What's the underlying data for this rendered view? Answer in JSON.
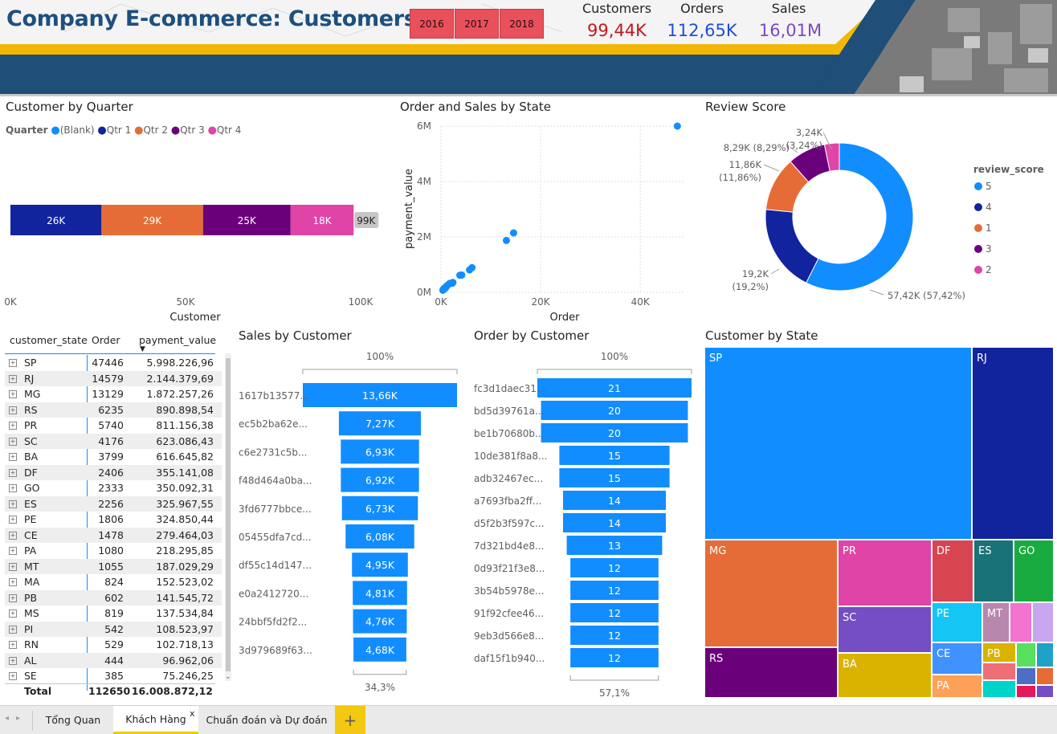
{
  "header": {
    "title": "Company E-commerce: Customers",
    "years": [
      "2016",
      "2017",
      "2018"
    ],
    "kpis": [
      {
        "label": "Customers",
        "value": "99,44K",
        "color": "#c4161c"
      },
      {
        "label": "Orders",
        "value": "112,65K",
        "color": "#1f4fd6"
      },
      {
        "label": "Sales",
        "value": "16,01M",
        "color": "#7b48c8"
      }
    ]
  },
  "colors": {
    "blue": "#118dff",
    "navy": "#12239e",
    "orange": "#e66c37",
    "purple": "#6b007b",
    "pink": "#e044a7",
    "header_band": "#1f4e79",
    "header_gold": "#f2b705"
  },
  "customer_by_quarter": {
    "title": "Customer by Quarter",
    "legend_title": "Quarter",
    "legend": [
      "(Blank)",
      "Qtr 1",
      "Qtr 2",
      "Qtr 3",
      "Qtr 4"
    ],
    "xlabel": "Customer",
    "ticks": [
      "0K",
      "50K",
      "100K"
    ]
  },
  "order_sales_by_state": {
    "title": "Order and Sales by State",
    "xlabel": "Order",
    "ylabel": "payment_value",
    "xticks": [
      "0K",
      "20K",
      "40K"
    ],
    "yticks": [
      "0M",
      "2M",
      "4M",
      "6M"
    ]
  },
  "review_score": {
    "title": "Review Score",
    "legend_title": "review_score",
    "legend": [
      "5",
      "4",
      "1",
      "3",
      "2"
    ],
    "labels": [
      "57,42K (57,42%)",
      "19,2K",
      "(19,2%)",
      "11,86K",
      "(11,86%)",
      "8,29K (8,29%)",
      "3,24K",
      "(3,24%)"
    ]
  },
  "table": {
    "headers": [
      "customer_state",
      "Order",
      "payment_value"
    ],
    "rows": [
      {
        "state": "SP",
        "order": "47446",
        "pay": "5.998.226,96"
      },
      {
        "state": "RJ",
        "order": "14579",
        "pay": "2.144.379,69"
      },
      {
        "state": "MG",
        "order": "13129",
        "pay": "1.872.257,26"
      },
      {
        "state": "RS",
        "order": "6235",
        "pay": "890.898,54"
      },
      {
        "state": "PR",
        "order": "5740",
        "pay": "811.156,38"
      },
      {
        "state": "SC",
        "order": "4176",
        "pay": "623.086,43"
      },
      {
        "state": "BA",
        "order": "3799",
        "pay": "616.645,82"
      },
      {
        "state": "DF",
        "order": "2406",
        "pay": "355.141,08"
      },
      {
        "state": "GO",
        "order": "2333",
        "pay": "350.092,31"
      },
      {
        "state": "ES",
        "order": "2256",
        "pay": "325.967,55"
      },
      {
        "state": "PE",
        "order": "1806",
        "pay": "324.850,44"
      },
      {
        "state": "CE",
        "order": "1478",
        "pay": "279.464,03"
      },
      {
        "state": "PA",
        "order": "1080",
        "pay": "218.295,85"
      },
      {
        "state": "MT",
        "order": "1055",
        "pay": "187.029,29"
      },
      {
        "state": "MA",
        "order": "824",
        "pay": "152.523,02"
      },
      {
        "state": "PB",
        "order": "602",
        "pay": "141.545,72"
      },
      {
        "state": "MS",
        "order": "819",
        "pay": "137.534,84"
      },
      {
        "state": "PI",
        "order": "542",
        "pay": "108.523,97"
      },
      {
        "state": "RN",
        "order": "529",
        "pay": "102.718,13"
      },
      {
        "state": "AL",
        "order": "444",
        "pay": "96.962,06"
      },
      {
        "state": "SE",
        "order": "385",
        "pay": "75.246,25"
      }
    ],
    "total": {
      "label": "Total",
      "order": "112650",
      "pay": "16.008.872,12"
    }
  },
  "sales_by_customer": {
    "title": "Sales by Customer",
    "top_pct": "100%",
    "bottom_pct": "34,3%"
  },
  "order_by_customer": {
    "title": "Order by Customer",
    "top_pct": "100%",
    "bottom_pct": "57,1%"
  },
  "customer_by_state": {
    "title": "Customer by State"
  },
  "tabs": {
    "items": [
      "Tổng Quan",
      "Khách Hàng",
      "Chuẩn đoán và Dự đoán"
    ],
    "close": "x",
    "add": "+"
  },
  "chart_data": [
    {
      "type": "bar",
      "title": "Customer by Quarter",
      "xlabel": "Customer",
      "categories": [
        ""
      ],
      "series": [
        {
          "name": "Qtr 1",
          "values": [
            26000
          ],
          "label": "26K"
        },
        {
          "name": "Qtr 2",
          "values": [
            29000
          ],
          "label": "29K"
        },
        {
          "name": "Qtr 3",
          "values": [
            25000
          ],
          "label": "25K"
        },
        {
          "name": "Qtr 4",
          "values": [
            18000
          ],
          "label": "18K"
        }
      ],
      "total_label": "99K",
      "xlim": [
        0,
        100000
      ]
    },
    {
      "type": "scatter",
      "title": "Order and Sales by State",
      "xlabel": "Order",
      "ylabel": "payment_value",
      "xlim": [
        0,
        49000
      ],
      "ylim": [
        0,
        6000000
      ],
      "points": [
        {
          "x": 47446,
          "y": 5998227
        },
        {
          "x": 14579,
          "y": 2144380
        },
        {
          "x": 13129,
          "y": 1872257
        },
        {
          "x": 6235,
          "y": 890899
        },
        {
          "x": 5740,
          "y": 811156
        },
        {
          "x": 4176,
          "y": 623086
        },
        {
          "x": 3799,
          "y": 616646
        },
        {
          "x": 2406,
          "y": 355141
        },
        {
          "x": 2333,
          "y": 350092
        },
        {
          "x": 2256,
          "y": 325968
        },
        {
          "x": 1806,
          "y": 324850
        },
        {
          "x": 1478,
          "y": 279464
        },
        {
          "x": 1080,
          "y": 218296
        },
        {
          "x": 1055,
          "y": 187029
        },
        {
          "x": 824,
          "y": 152523
        },
        {
          "x": 602,
          "y": 141546
        },
        {
          "x": 819,
          "y": 137535
        },
        {
          "x": 542,
          "y": 108524
        },
        {
          "x": 529,
          "y": 102718
        },
        {
          "x": 444,
          "y": 96962
        },
        {
          "x": 385,
          "y": 75246
        }
      ]
    },
    {
      "type": "pie",
      "title": "Review Score",
      "slices": [
        {
          "label": "5",
          "value": 57420
        },
        {
          "label": "4",
          "value": 19200
        },
        {
          "label": "1",
          "value": 11860
        },
        {
          "label": "3",
          "value": 8290
        },
        {
          "label": "2",
          "value": 3240
        }
      ]
    },
    {
      "type": "bar",
      "title": "Sales by Customer",
      "categories": [
        "1617b13577...",
        "ec5b2ba62e...",
        "c6e2731c5b...",
        "f48d464a0ba...",
        "3fd6777bbce...",
        "05455dfa7cd...",
        "df55c14d147...",
        "e0a2412720...",
        "24bbf5fd2f2...",
        "3d979689f63..."
      ],
      "values": [
        13660,
        7270,
        6930,
        6920,
        6730,
        6080,
        4950,
        4810,
        4760,
        4680
      ],
      "value_labels": [
        "13,66K",
        "7,27K",
        "6,93K",
        "6,92K",
        "6,73K",
        "6,08K",
        "4,95K",
        "4,81K",
        "4,76K",
        "4,68K"
      ]
    },
    {
      "type": "bar",
      "title": "Order by Customer",
      "categories": [
        "fc3d1daec31...",
        "bd5d39761a...",
        "be1b70680b...",
        "10de381f8a8...",
        "adb32467ec...",
        "a7693fba2ff...",
        "d5f2b3f597c...",
        "7d321bd4e8...",
        "0d93f21f3e8...",
        "3b54b5978e...",
        "91f92cfee46...",
        "9eb3d566e8...",
        "daf15f1b940..."
      ],
      "values": [
        21,
        20,
        20,
        15,
        15,
        14,
        14,
        13,
        12,
        12,
        12,
        12,
        12
      ]
    },
    {
      "type": "heatmap",
      "title": "Customer by State",
      "categories": [
        "SP",
        "RJ",
        "MG",
        "PR",
        "DF",
        "ES",
        "GO",
        "SC",
        "PE",
        "MT",
        "RS",
        "BA",
        "CE",
        "PB",
        "PA"
      ],
      "values": [
        41746,
        12852,
        11635,
        5045,
        2140,
        2033,
        2020,
        3637,
        1652,
        907,
        5466,
        3380,
        1336,
        536,
        975
      ]
    }
  ]
}
